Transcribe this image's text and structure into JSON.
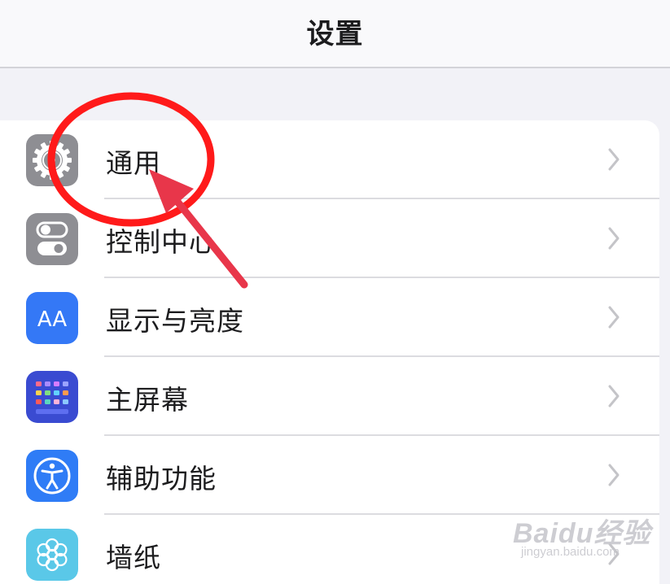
{
  "nav": {
    "title": "设置"
  },
  "settings": {
    "items": [
      {
        "label": "通用",
        "icon": "gear-icon",
        "icon_color": "#8e8e93"
      },
      {
        "label": "控制中心",
        "icon": "toggle-switches-icon",
        "icon_color": "#8e8e93"
      },
      {
        "label": "显示与亮度",
        "icon": "text-size-icon",
        "icon_color": "#3478f6"
      },
      {
        "label": "主屏幕",
        "icon": "home-screen-grid-icon",
        "icon_color": "#3a4bd1"
      },
      {
        "label": "辅助功能",
        "icon": "accessibility-icon",
        "icon_color": "#2f7cf6"
      },
      {
        "label": "墙纸",
        "icon": "flower-icon",
        "icon_color": "#5ac8e8"
      }
    ],
    "display_icon_text": "AA"
  },
  "annotation": {
    "circle_color": "#ff1a1a",
    "arrow_color": "#e8364a"
  },
  "watermark": {
    "brand": "Baidu经验",
    "url": "jingyan.baidu.com"
  }
}
